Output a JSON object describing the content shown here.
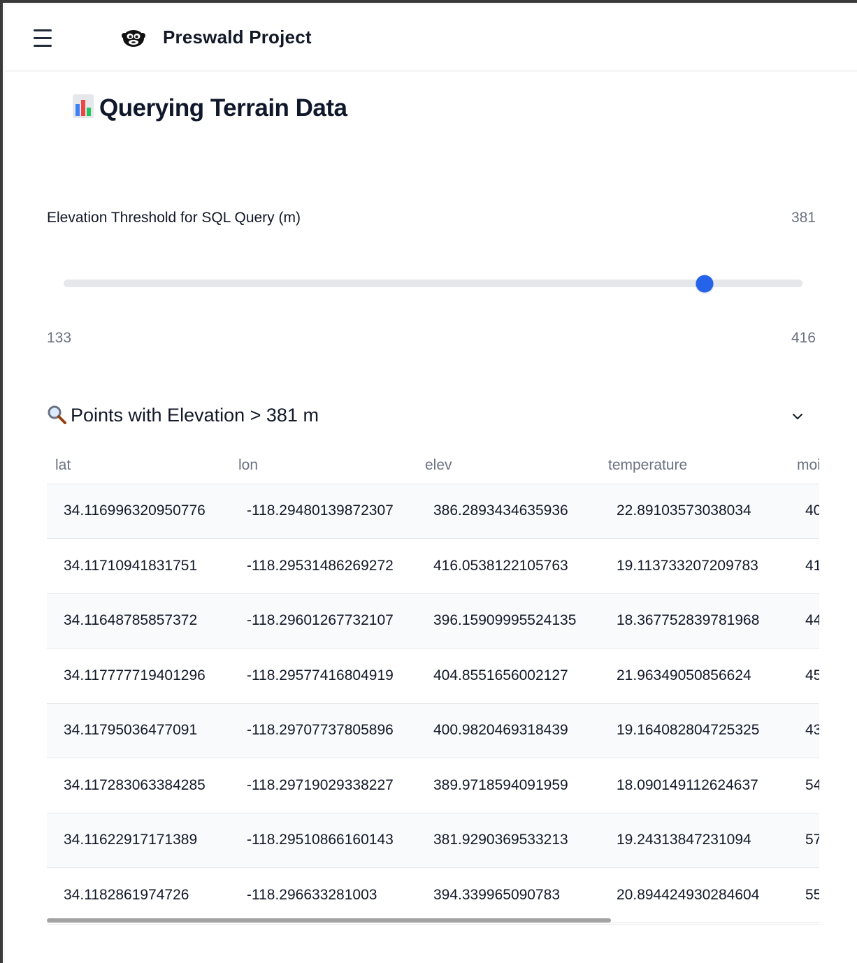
{
  "header": {
    "menu_icon": "hamburger-menu-icon",
    "logo_icon": "monkey-face-icon",
    "app_title": "Preswald Project"
  },
  "page": {
    "title_icon": "bar-chart-icon",
    "title": "Querying Terrain Data"
  },
  "slider": {
    "label": "Elevation Threshold for SQL Query (m)",
    "value": "381",
    "min": "133",
    "max": "416",
    "position_fraction": 0.868
  },
  "section": {
    "icon": "magnifying-glass-icon",
    "title": "Points with Elevation > 381 m",
    "toggle_icon": "chevron-down-icon"
  },
  "table": {
    "columns": [
      "lat",
      "lon",
      "elev",
      "temperature",
      "moi"
    ],
    "rows": [
      [
        "34.116996320950776",
        "-118.29480139872307",
        "386.2893434635936",
        "22.89103573038034",
        "40"
      ],
      [
        "34.11710941831751",
        "-118.29531486269272",
        "416.0538122105763",
        "19.113733207209783",
        "41"
      ],
      [
        "34.11648785857372",
        "-118.29601267732107",
        "396.15909995524135",
        "18.367752839781968",
        "44"
      ],
      [
        "34.117777719401296",
        "-118.29577416804919",
        "404.8551656002127",
        "21.96349050856624",
        "45"
      ],
      [
        "34.11795036477091",
        "-118.29707737805896",
        "400.9820469318439",
        "19.164082804725325",
        "43"
      ],
      [
        "34.117283063384285",
        "-118.29719029338227",
        "389.9718594091959",
        "18.090149112624637",
        "54"
      ],
      [
        "34.11622917171389",
        "-118.29510866160143",
        "381.9290369533213",
        "19.24313847231094",
        "57"
      ],
      [
        "34.1182861974726",
        "-118.296633281003",
        "394.339965090783",
        "20.894424930284604",
        "55"
      ]
    ],
    "scroll_fraction": 0.73
  },
  "colors": {
    "accent": "#2563eb",
    "track": "#e5e7eb",
    "muted_text": "#6b7280",
    "row_alt": "#f9fafb"
  }
}
